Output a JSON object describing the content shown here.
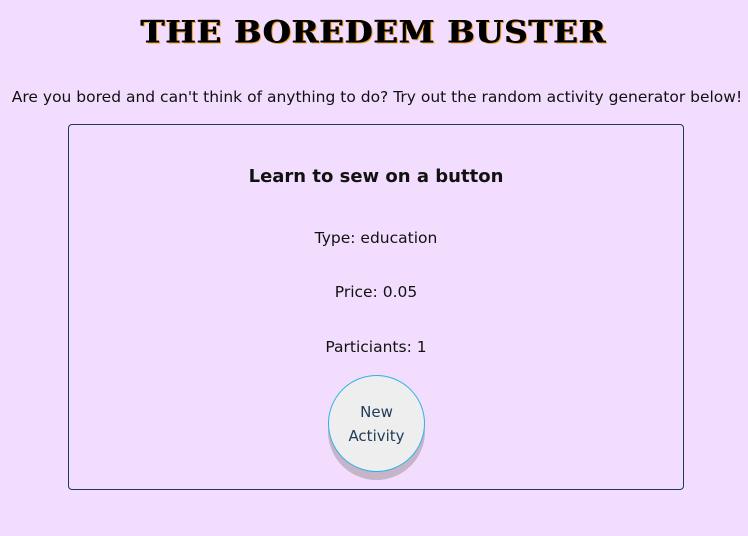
{
  "header": {
    "title": "THE BOREDEM BUSTER",
    "intro": "Are you bored and can't think of anything to do? Try out the random activity generator below!"
  },
  "activity": {
    "title": "Learn to sew on a button",
    "type": "Type: education",
    "price": "Price: 0.05",
    "participants": "Particiants: 1"
  },
  "actions": {
    "new_activity_label": "New Activity"
  },
  "colors": {
    "background": "#f3ddfe",
    "card_border": "#1f3b57",
    "button_border": "#2bb3e6",
    "button_fill": "#eeeeee"
  }
}
